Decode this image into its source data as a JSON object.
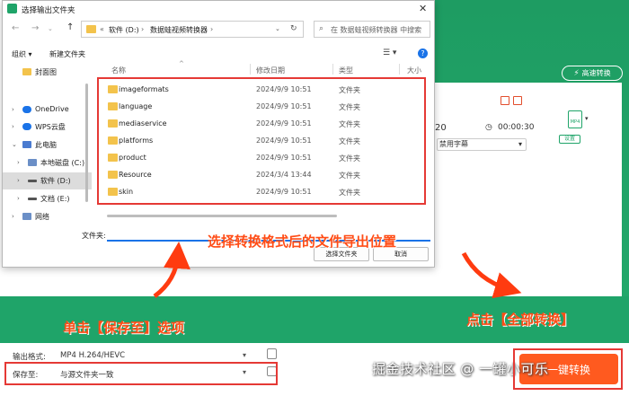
{
  "dialog": {
    "title": "选择输出文件夹",
    "close_glyph": "✕",
    "nav": {
      "back": "←",
      "forward": "→",
      "up": "↑"
    },
    "path": {
      "chevron": "«",
      "crumbs": [
        "软件 (D:)",
        "数据蛙视频转换器"
      ],
      "separator": "›",
      "dropdown": "⌄",
      "refresh": "↻"
    },
    "search_placeholder": "在 数据蛙视频转换器 中搜索",
    "toolbar": {
      "organize": "组织 ▾",
      "new_folder": "新建文件夹",
      "view": "☰ ▾",
      "help": "?"
    },
    "sidebar": [
      {
        "label": "封面图",
        "chevron": "",
        "icon_color": "#f3c34c"
      },
      {
        "label": "OneDrive",
        "chevron": "›",
        "icon_color": "#1a73e8"
      },
      {
        "label": "WPS云盘",
        "chevron": "›",
        "icon_color": "#1a73e8"
      },
      {
        "label": "此电脑",
        "chevron": "⌄",
        "icon_color": "#4a7bd0"
      },
      {
        "label": "本地磁盘 (C:)",
        "chevron": "›",
        "icon_color": "#6b8fc7"
      },
      {
        "label": "软件 (D:)",
        "chevron": "›",
        "icon_color": "#555555"
      },
      {
        "label": "文档 (E:)",
        "chevron": "›",
        "icon_color": "#555555"
      },
      {
        "label": "网络",
        "chevron": "›",
        "icon_color": "#6b8fc7"
      }
    ],
    "columns": {
      "name": "名称",
      "date": "修改日期",
      "type": "类型",
      "size": "大小",
      "sort": "^"
    },
    "files": [
      {
        "name": "imageformats",
        "date": "2024/9/9 10:51",
        "type": "文件夹"
      },
      {
        "name": "language",
        "date": "2024/9/9 10:51",
        "type": "文件夹"
      },
      {
        "name": "mediaservice",
        "date": "2024/9/9 10:51",
        "type": "文件夹"
      },
      {
        "name": "platforms",
        "date": "2024/9/9 10:51",
        "type": "文件夹"
      },
      {
        "name": "product",
        "date": "2024/9/9 10:51",
        "type": "文件夹"
      },
      {
        "name": "Resource",
        "date": "2024/3/4 13:44",
        "type": "文件夹"
      },
      {
        "name": "skin",
        "date": "2024/9/9 10:51",
        "type": "文件夹"
      }
    ],
    "folder_label": "文件夹:",
    "folder_value": "",
    "select_button": "选择文件夹",
    "cancel_button": "取消"
  },
  "app": {
    "speed_button": "高速转换",
    "speed_icon": "⚡",
    "card_number": "20",
    "clock_glyph": "◷",
    "duration": "00:00:30",
    "subtitle_select": "禁用字幕",
    "subtitle_caret": "▾",
    "file_format_badge": "MP4",
    "file_caret": "▾",
    "settings_chip": "设置",
    "output_format_label": "输出格式:",
    "output_format_value": "MP4 H.264/HEVC",
    "save_to_label": "保存至:",
    "save_to_value": "与源文件夹一致",
    "caret": "▾",
    "convert_all": "一键转换"
  },
  "annotations": {
    "export_location": "选择转换格式后的文件导出位置",
    "save_to_hint": "单击【保存至】选项",
    "convert_all_hint": "点击【全部转换】",
    "watermark": "掘金技术社区 @ 一罐小可乐"
  },
  "colors": {
    "brand_green": "#1fa469",
    "annotation_red": "#e53935",
    "annotation_text": "#ff4d17",
    "convert_orange": "#ff5a1f",
    "folder_yellow": "#f3c34c"
  }
}
